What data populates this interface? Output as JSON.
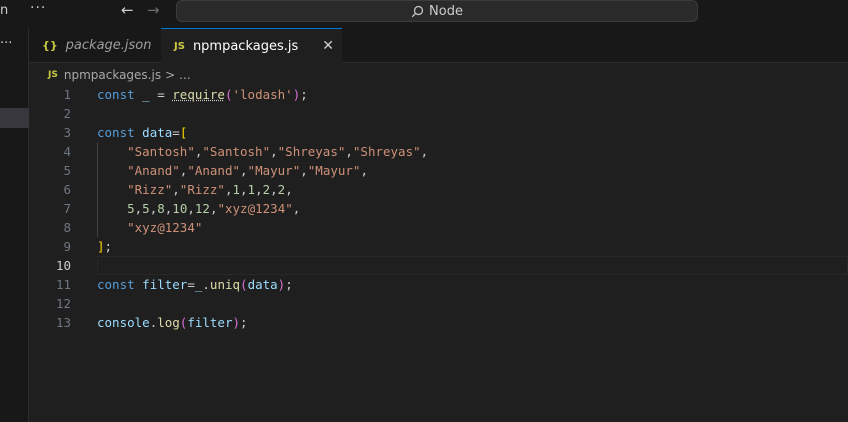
{
  "titlebar": {
    "menu_fragment": "n",
    "more": "···",
    "search_text": "Node"
  },
  "tabs": [
    {
      "icon": "{}",
      "label": "package.json"
    },
    {
      "icon": "JS",
      "label": "npmpackages.js",
      "close": "✕"
    }
  ],
  "breadcrumb": {
    "icon": "JS",
    "file": "npmpackages.js",
    "sep": ">",
    "more": "..."
  },
  "editor": {
    "current_line": 10,
    "lines": [
      {
        "n": "1",
        "tokens": [
          [
            "kw",
            "const"
          ],
          [
            "pl",
            " "
          ],
          [
            "var",
            "_"
          ],
          [
            "pl",
            " = "
          ],
          [
            "fn",
            "require"
          ],
          [
            "br2",
            "("
          ],
          [
            "str",
            "'lodash'"
          ],
          [
            "br2",
            ")"
          ],
          [
            "pl",
            ";"
          ]
        ]
      },
      {
        "n": "2",
        "tokens": []
      },
      {
        "n": "3",
        "tokens": [
          [
            "kw",
            "const"
          ],
          [
            "pl",
            " "
          ],
          [
            "var",
            "data"
          ],
          [
            "pl",
            "="
          ],
          [
            "br1",
            "["
          ]
        ]
      },
      {
        "n": "4",
        "tokens": [
          [
            "pl",
            "    "
          ],
          [
            "str",
            "\"Santosh\""
          ],
          [
            "pl",
            ","
          ],
          [
            "str",
            "\"Santosh\""
          ],
          [
            "pl",
            ","
          ],
          [
            "str",
            "\"Shreyas\""
          ],
          [
            "pl",
            ","
          ],
          [
            "str",
            "\"Shreyas\""
          ],
          [
            "pl",
            ","
          ]
        ]
      },
      {
        "n": "5",
        "tokens": [
          [
            "pl",
            "    "
          ],
          [
            "str",
            "\"Anand\""
          ],
          [
            "pl",
            ","
          ],
          [
            "str",
            "\"Anand\""
          ],
          [
            "pl",
            ","
          ],
          [
            "str",
            "\"Mayur\""
          ],
          [
            "pl",
            ","
          ],
          [
            "str",
            "\"Mayur\""
          ],
          [
            "pl",
            ","
          ]
        ]
      },
      {
        "n": "6",
        "tokens": [
          [
            "pl",
            "    "
          ],
          [
            "str",
            "\"Rizz\""
          ],
          [
            "pl",
            ","
          ],
          [
            "str",
            "\"Rizz\""
          ],
          [
            "pl",
            ","
          ],
          [
            "num",
            "1"
          ],
          [
            "pl",
            ","
          ],
          [
            "num",
            "1"
          ],
          [
            "pl",
            ","
          ],
          [
            "num",
            "2"
          ],
          [
            "pl",
            ","
          ],
          [
            "num",
            "2"
          ],
          [
            "pl",
            ","
          ]
        ]
      },
      {
        "n": "7",
        "tokens": [
          [
            "pl",
            "    "
          ],
          [
            "num",
            "5"
          ],
          [
            "pl",
            ","
          ],
          [
            "num",
            "5"
          ],
          [
            "pl",
            ","
          ],
          [
            "num",
            "8"
          ],
          [
            "pl",
            ","
          ],
          [
            "num",
            "10"
          ],
          [
            "pl",
            ","
          ],
          [
            "num",
            "12"
          ],
          [
            "pl",
            ","
          ],
          [
            "str",
            "\"xyz@1234\""
          ],
          [
            "pl",
            ","
          ]
        ]
      },
      {
        "n": "8",
        "tokens": [
          [
            "pl",
            "    "
          ],
          [
            "str",
            "\"xyz@1234\""
          ]
        ]
      },
      {
        "n": "9",
        "tokens": [
          [
            "br1",
            "]"
          ],
          [
            "pl",
            ";"
          ]
        ]
      },
      {
        "n": "10",
        "tokens": []
      },
      {
        "n": "11",
        "tokens": [
          [
            "kw",
            "const"
          ],
          [
            "pl",
            " "
          ],
          [
            "var",
            "filter"
          ],
          [
            "pl",
            "="
          ],
          [
            "var",
            "_"
          ],
          [
            "pl",
            "."
          ],
          [
            "fn",
            "uniq"
          ],
          [
            "br2",
            "("
          ],
          [
            "var",
            "data"
          ],
          [
            "br2",
            ")"
          ],
          [
            "pl",
            ";"
          ]
        ]
      },
      {
        "n": "12",
        "tokens": []
      },
      {
        "n": "13",
        "tokens": [
          [
            "var",
            "console"
          ],
          [
            "pl",
            "."
          ],
          [
            "fn",
            "log"
          ],
          [
            "br2",
            "("
          ],
          [
            "var",
            "filter"
          ],
          [
            "br2",
            ")"
          ],
          [
            "pl",
            ";"
          ]
        ]
      }
    ]
  }
}
